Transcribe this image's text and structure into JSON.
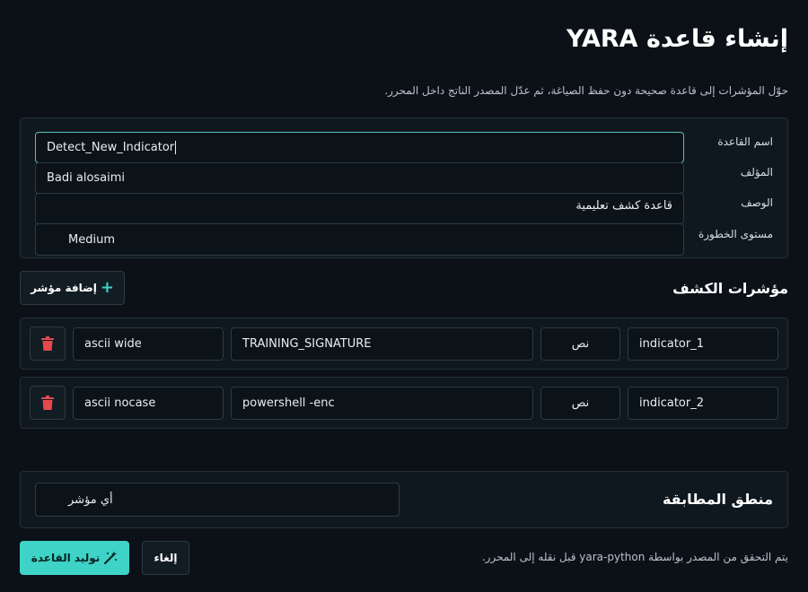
{
  "page": {
    "title": "إنشاء قاعدة YARA",
    "subtitle": "حوّل المؤشرات إلى قاعدة صحيحة دون حفظ الصياغة، ثم عدّل المصدر الناتج داخل المحرر."
  },
  "form": {
    "rule_name_label": "اسم القاعدة",
    "rule_name_value": "Detect_New_Indicator",
    "author_label": "المؤلف",
    "author_value": "Badi alosaimi",
    "description_label": "الوصف",
    "description_value": "قاعدة كشف تعليمية",
    "severity_label": "مستوى الخطورة",
    "severity_value": "Medium"
  },
  "indicators": {
    "section_title": "مؤشرات الكشف",
    "add_button_label": "إضافة مؤشر",
    "rows": [
      {
        "name": "indicator_1",
        "type": "نص",
        "value": "TRAINING_SIGNATURE",
        "modifiers": "ascii wide"
      },
      {
        "name": "indicator_2",
        "type": "نص",
        "value": "powershell -enc",
        "modifiers": "ascii nocase"
      }
    ]
  },
  "matching": {
    "section_title": "منطق المطابقة",
    "selected": "أي مؤشر"
  },
  "footer": {
    "note": "يتم التحقق من المصدر بواسطة yara-python قبل نقله إلى المحرر.",
    "cancel_label": "إلغاء",
    "generate_label": "توليد القاعدة"
  },
  "colors": {
    "background": "#0b1117",
    "accent": "#3ed3c6",
    "danger": "#e5484d",
    "border": "#2c3a44"
  }
}
